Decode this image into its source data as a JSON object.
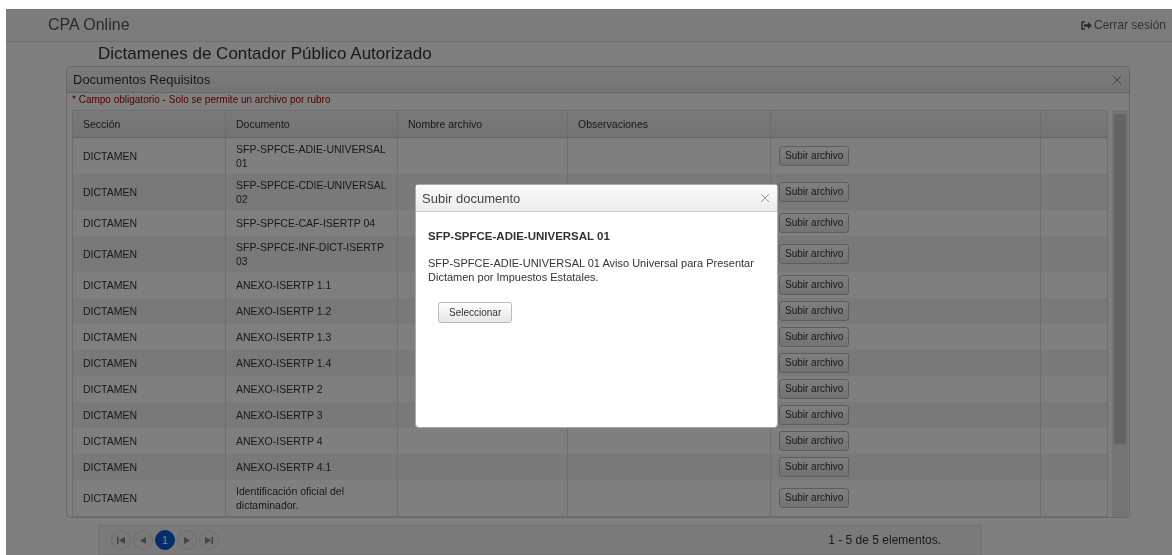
{
  "navbar": {
    "brand": "CPA Online",
    "logout": "Cerrar sesión"
  },
  "page": {
    "heading": "Dictamenes de Contador Público Autorizado",
    "pager": {
      "pages": [
        {
          "label": "1",
          "selected": true
        }
      ],
      "summary": "1 - 5 de 5 elementos."
    }
  },
  "dialog": {
    "title": "Documentos Requisitos",
    "note": "* Campo obligatorio - Solo se permite un archivo por rubro",
    "columns": [
      "Sección",
      "Documento",
      "Nombre archivo",
      "Observaciones"
    ],
    "rows": [
      {
        "section": "DICTAMEN",
        "document": "SFP-SPFCE-ADIE-UNIVERSAL 01",
        "action": "Subir archivo"
      },
      {
        "section": "DICTAMEN",
        "document": "SFP-SPFCE-CDIE-UNIVERSAL 02",
        "action": "Subir archivo"
      },
      {
        "section": "DICTAMEN",
        "document": "SFP-SPFCE-CAF-ISERTP 04",
        "action": "Subir archivo"
      },
      {
        "section": "DICTAMEN",
        "document": "SFP-SPFCE-INF-DICT-ISERTP 03",
        "action": "Subir archivo"
      },
      {
        "section": "DICTAMEN",
        "document": "ANEXO-ISERTP 1.1",
        "action": "Subir archivo"
      },
      {
        "section": "DICTAMEN",
        "document": "ANEXO-ISERTP 1.2",
        "action": "Subir archivo"
      },
      {
        "section": "DICTAMEN",
        "document": "ANEXO-ISERTP 1.3",
        "action": "Subir archivo"
      },
      {
        "section": "DICTAMEN",
        "document": "ANEXO-ISERTP 1.4",
        "action": "Subir archivo"
      },
      {
        "section": "DICTAMEN",
        "document": "ANEXO-ISERTP 2",
        "action": "Subir archivo"
      },
      {
        "section": "DICTAMEN",
        "document": "ANEXO-ISERTP 3",
        "action": "Subir archivo"
      },
      {
        "section": "DICTAMEN",
        "document": "ANEXO-ISERTP 4",
        "action": "Subir archivo"
      },
      {
        "section": "DICTAMEN",
        "document": "ANEXO-ISERTP 4.1",
        "action": "Subir archivo"
      },
      {
        "section": "DICTAMEN",
        "document": "Identificación oficial del dictaminador.",
        "action": "Subir archivo"
      }
    ]
  },
  "modal": {
    "title": "Subir documento",
    "document": "SFP-SPFCE-ADIE-UNIVERSAL 01",
    "description": "SFP-SPFCE-ADIE-UNIVERSAL 01 Aviso Universal para Presentar Dictamen por Impuestos Estatales.",
    "button": "Seleccionar"
  }
}
